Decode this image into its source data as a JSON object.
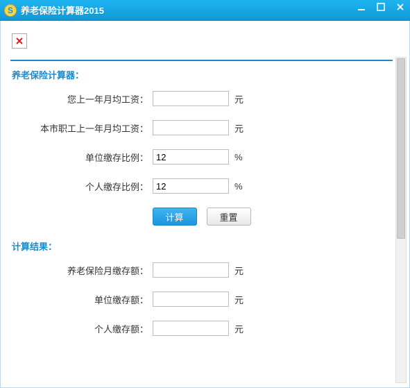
{
  "window": {
    "title": "养老保险计算器2015"
  },
  "form": {
    "section_title": "养老保险计算器：",
    "fields": {
      "own_avg_salary": {
        "label": "您上一年月均工资：",
        "value": "",
        "unit": "元"
      },
      "city_avg_salary": {
        "label": "本市职工上一年月均工资：",
        "value": "",
        "unit": "元"
      },
      "employer_rate": {
        "label": "单位缴存比例：",
        "value": "12",
        "unit": "%"
      },
      "personal_rate": {
        "label": "个人缴存比例：",
        "value": "12",
        "unit": "%"
      }
    },
    "buttons": {
      "calc": "计算",
      "reset": "重置"
    }
  },
  "results": {
    "section_title": "计算结果：",
    "fields": {
      "monthly_total": {
        "label": "养老保险月缴存额：",
        "value": "",
        "unit": "元"
      },
      "employer_amt": {
        "label": "单位缴存额：",
        "value": "",
        "unit": "元"
      },
      "personal_amt": {
        "label": "个人缴存额：",
        "value": "",
        "unit": "元"
      }
    }
  }
}
